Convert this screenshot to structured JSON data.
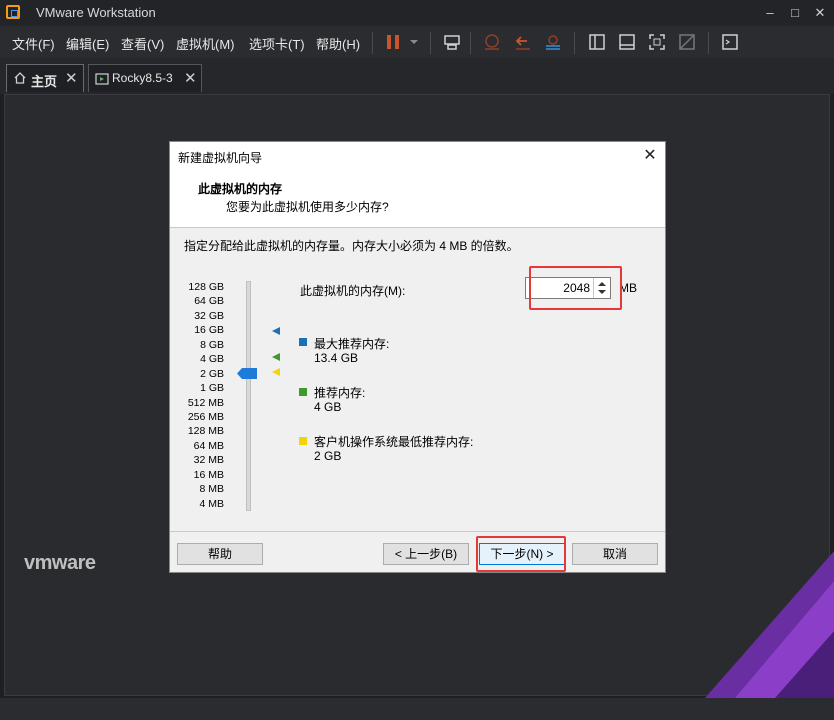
{
  "window": {
    "title": "VMware Workstation",
    "controls": [
      "–",
      "□",
      "✕"
    ]
  },
  "menu": [
    "文件(F)",
    "编辑(E)",
    "查看(V)",
    "虚拟机(M)",
    "选项卡(T)",
    "帮助(H)"
  ],
  "tabs": [
    {
      "label": "主页",
      "icon": "home-icon"
    },
    {
      "label": "Rocky8.5-3",
      "icon": "vm-icon"
    }
  ],
  "brand": "vmware",
  "dialog": {
    "title": "新建虚拟机向导",
    "header_title": "此虚拟机的内存",
    "header_subtitle": "您要为此虚拟机使用多少内存?",
    "instruction": "指定分配给此虚拟机的内存量。内存大小必须为 4 MB 的倍数。",
    "scale_labels": [
      "128 GB",
      "64 GB",
      "32 GB",
      "16 GB",
      "8 GB",
      "4 GB",
      "2 GB",
      "1 GB",
      "512 MB",
      "256 MB",
      "128 MB",
      "64 MB",
      "32 MB",
      "16 MB",
      "8 MB",
      "4 MB"
    ],
    "memory_label": "此虚拟机的内存(M):",
    "memory_value": "2048",
    "memory_unit": "MB",
    "legend": [
      {
        "color": "#1f6fb5",
        "title": "最大推荐内存:",
        "value": "13.4 GB"
      },
      {
        "color": "#3c9b2a",
        "title": "推荐内存:",
        "value": "4 GB"
      },
      {
        "color": "#f2d40c",
        "title": "客户机操作系统最低推荐内存:",
        "value": "2 GB"
      }
    ],
    "buttons": {
      "help": "帮助",
      "back": "< 上一步(B)",
      "next": "下一步(N) >",
      "cancel": "取消"
    }
  }
}
